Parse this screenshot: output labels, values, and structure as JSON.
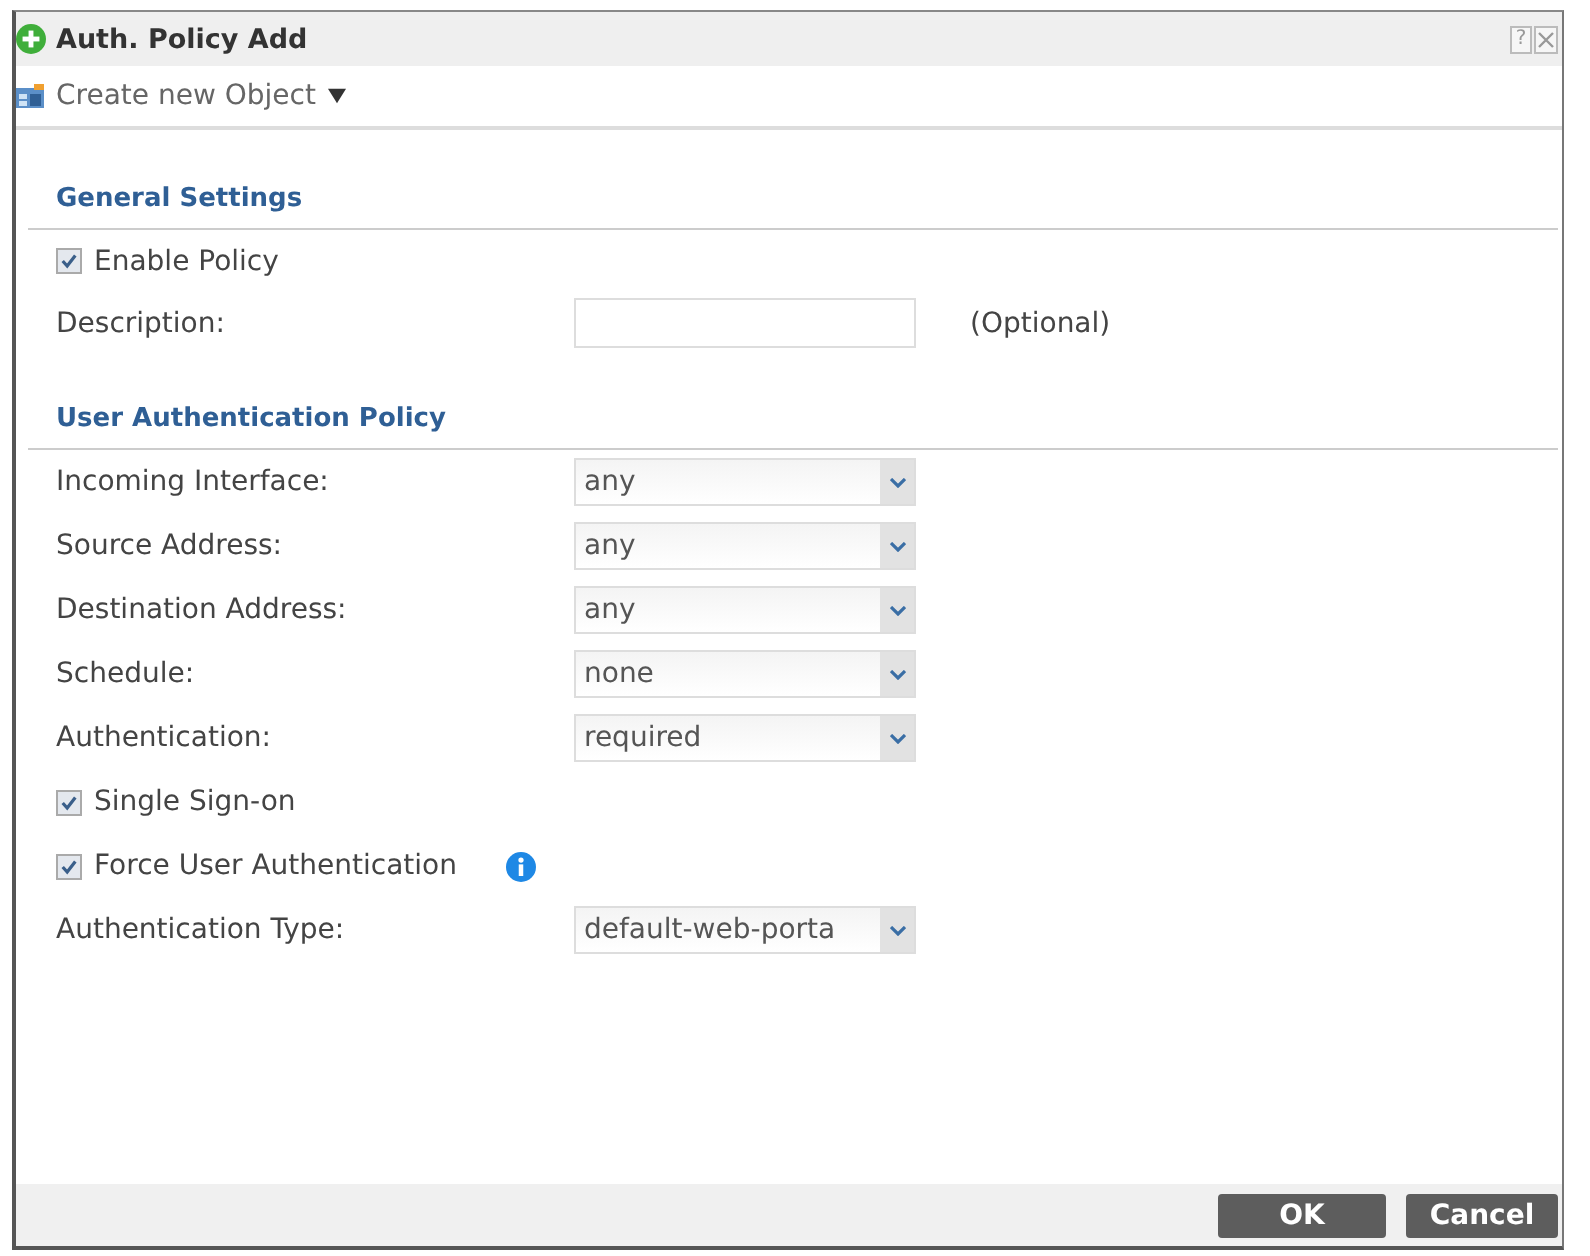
{
  "window": {
    "title": "Auth. Policy Add",
    "help": "?"
  },
  "toolbar": {
    "menu": "Create new Object"
  },
  "sections": [
    {
      "title": "General Settings",
      "fields": [
        {
          "kind": "checkbox",
          "label": "Enable Policy",
          "checked": true
        },
        {
          "kind": "text",
          "label": "Description:",
          "note": "(Optional)"
        }
      ]
    },
    {
      "title": "User Authentication Policy",
      "fields": [
        {
          "kind": "select",
          "label": "Incoming Interface:",
          "value": "any"
        },
        {
          "kind": "select",
          "label": "Source Address:",
          "value": "any"
        },
        {
          "kind": "select",
          "label": "Destination Address:",
          "value": "any"
        },
        {
          "kind": "select",
          "label": "Schedule:",
          "value": "none"
        },
        {
          "kind": "select",
          "label": "Authentication:",
          "value": "required"
        },
        {
          "kind": "checkbox",
          "label": "Single Sign-on",
          "checked": true
        },
        {
          "kind": "checkbox",
          "label": "Force User Authentication",
          "checked": true,
          "info": true
        },
        {
          "kind": "select",
          "label": "Authentication Type:",
          "value": "default-web-porta"
        }
      ]
    }
  ],
  "buttons": [
    {
      "label": "OK"
    },
    {
      "label": "Cancel"
    }
  ]
}
